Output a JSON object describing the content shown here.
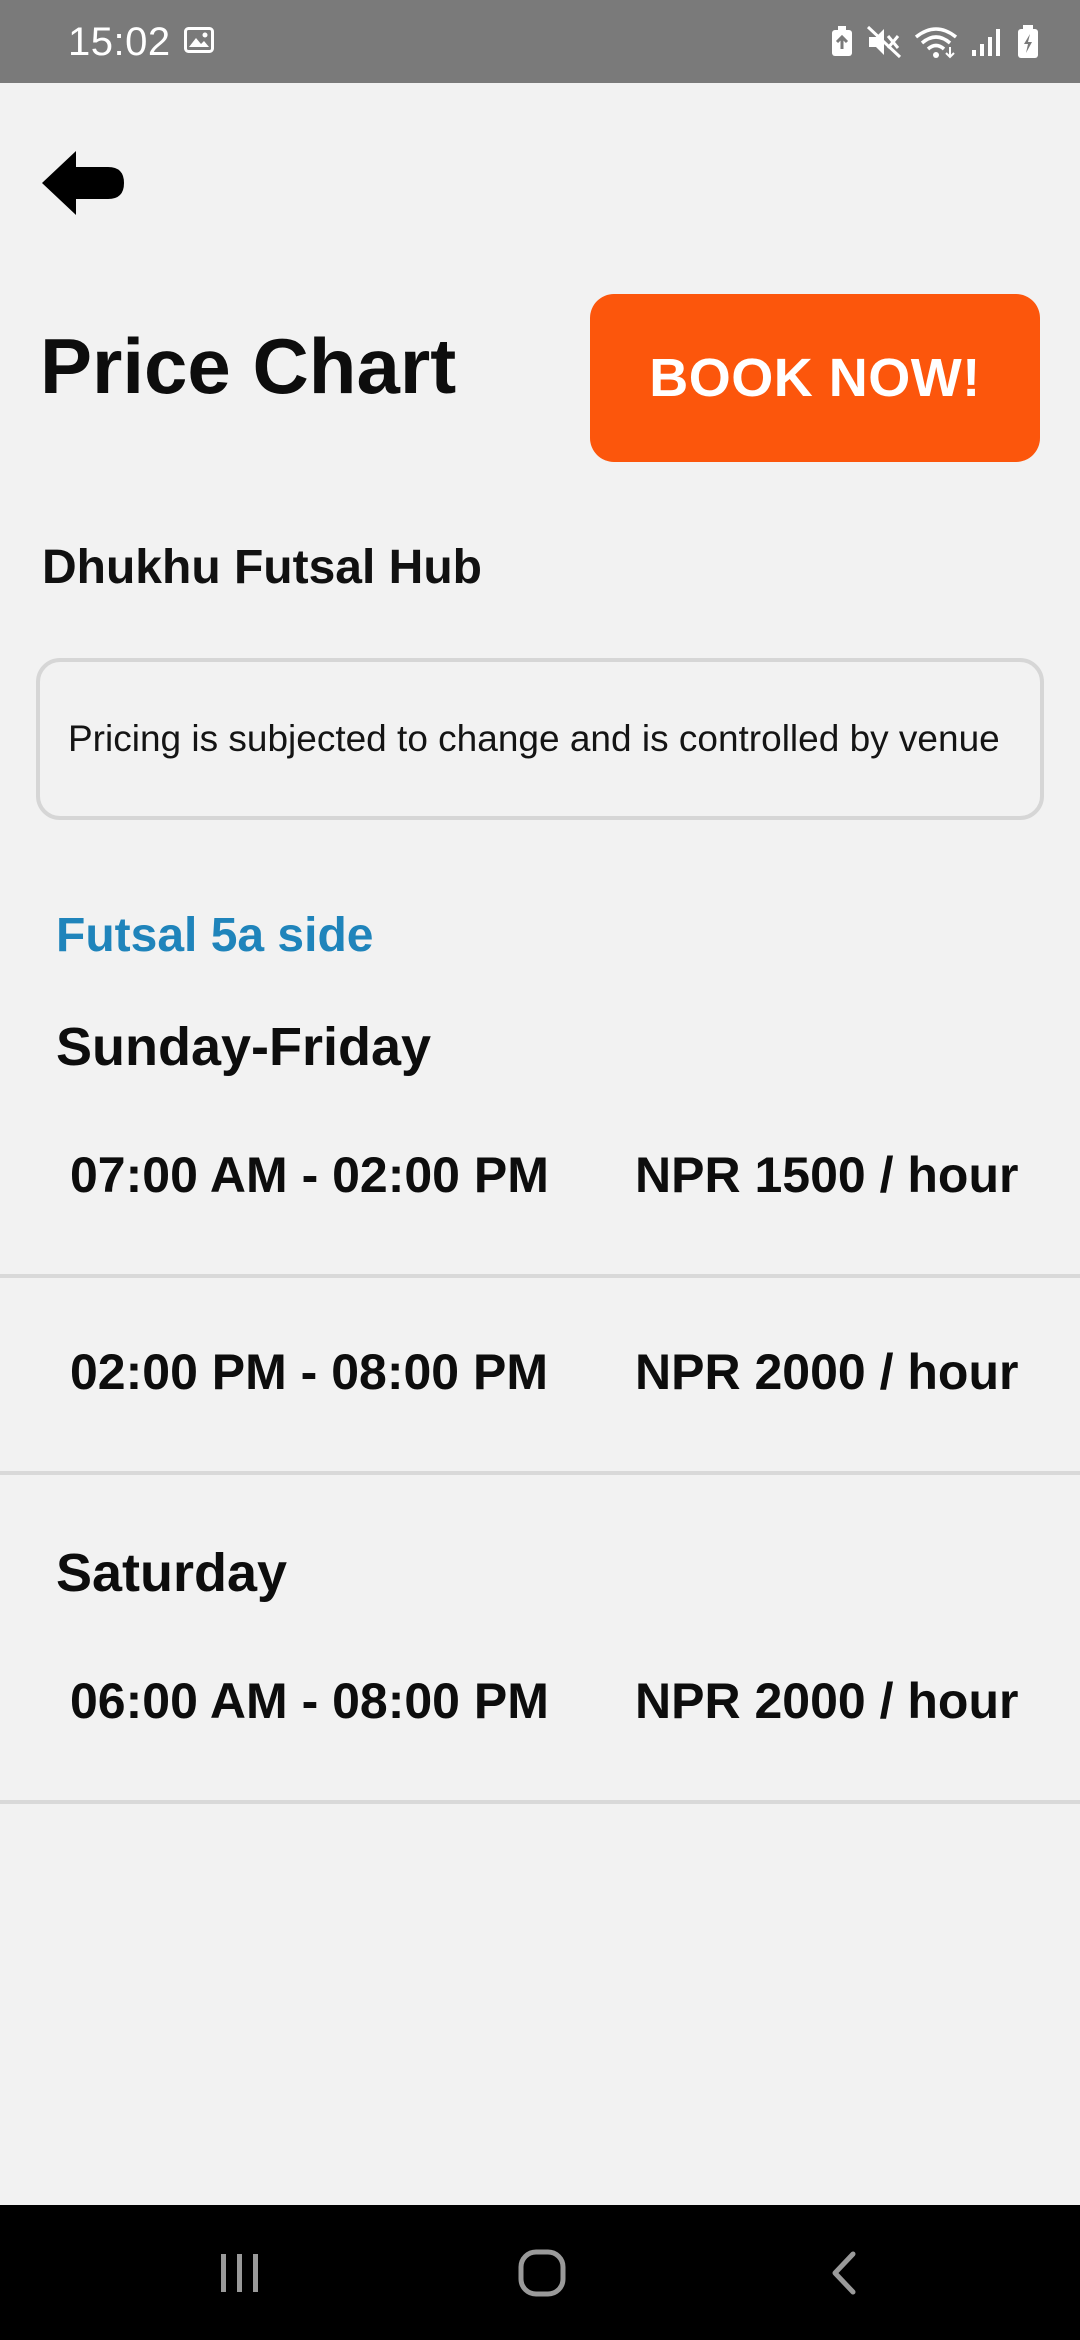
{
  "status_bar": {
    "time": "15:02",
    "icons": [
      "gallery-icon",
      "battery-saver-icon",
      "mute-icon",
      "wifi-icon",
      "signal-icon",
      "battery-charging-icon"
    ]
  },
  "header": {
    "back_icon": "arrow-left-icon",
    "title": "Price Chart",
    "book_button_label": "BOOK NOW!"
  },
  "venue": {
    "name": "Dhukhu Futsal Hub",
    "notice": "Pricing is subjected to change and is controlled by venue"
  },
  "category": "Futsal 5a side",
  "schedules": [
    {
      "day": "Sunday-Friday",
      "slots": [
        {
          "time": "07:00 AM - 02:00 PM",
          "price": "NPR 1500 / hour"
        },
        {
          "time": "02:00 PM - 08:00 PM",
          "price": "NPR 2000 / hour"
        }
      ]
    },
    {
      "day": "Saturday",
      "slots": [
        {
          "time": "06:00 AM - 08:00 PM",
          "price": "NPR 2000 / hour"
        }
      ]
    }
  ],
  "navigation_bar": {
    "buttons": [
      "recent-apps-icon",
      "home-icon",
      "back-icon"
    ]
  },
  "colors": {
    "accent": "#fc560c",
    "category": "#1f84bb",
    "background": "#f2f2f2",
    "status_bar": "#7a7a7a"
  }
}
